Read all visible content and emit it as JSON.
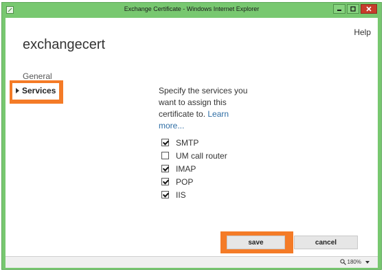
{
  "window": {
    "title": "Exchange Certificate - Windows Internet Explorer",
    "icon": "ie-app-icon",
    "controls": [
      "minimize-icon",
      "maximize-icon",
      "close-icon"
    ],
    "frame_color": "#78c870"
  },
  "header": {
    "help_label": "Help",
    "page_title": "exchangecert"
  },
  "sidebar": {
    "items": [
      {
        "label": "General",
        "selected": false
      },
      {
        "label": "Services",
        "selected": true
      }
    ]
  },
  "main": {
    "description": "Specify the services you want to assign this certificate to.",
    "learn_more_label": "Learn more...",
    "services": [
      {
        "label": "SMTP",
        "checked": true
      },
      {
        "label": "UM call router",
        "checked": false
      },
      {
        "label": "IMAP",
        "checked": true
      },
      {
        "label": "POP",
        "checked": true
      },
      {
        "label": "IIS",
        "checked": true
      }
    ]
  },
  "actions": {
    "save_label": "save",
    "cancel_label": "cancel",
    "highlight_color": "#f47b27"
  },
  "statusbar": {
    "zoom_label": "180%"
  }
}
